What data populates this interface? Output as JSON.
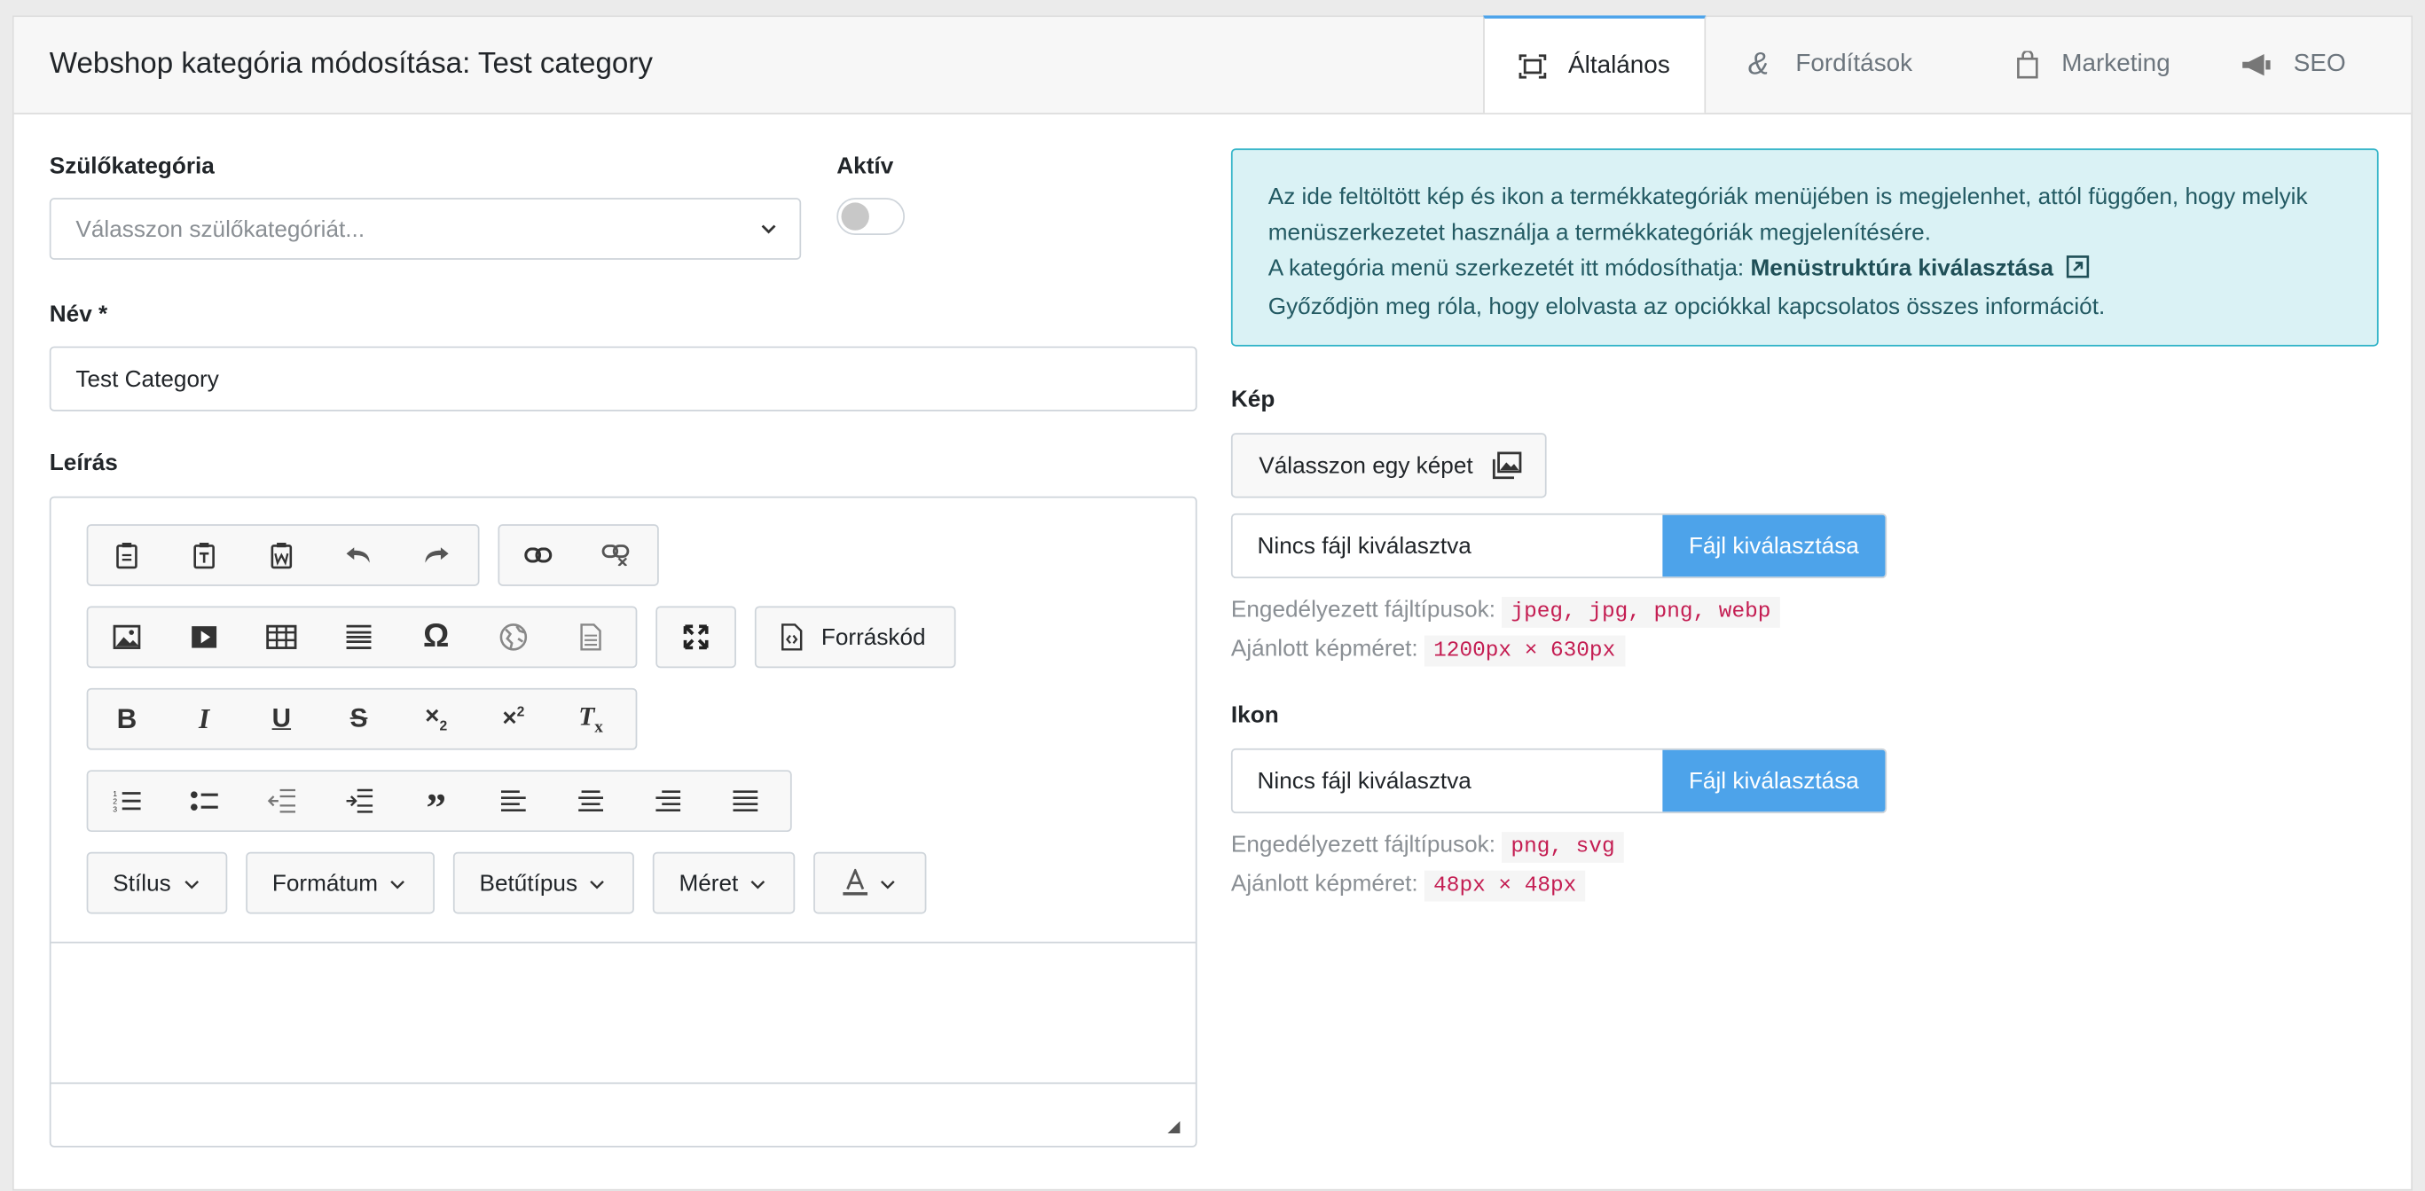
{
  "header": {
    "title": "Webshop kategória módosítása: Test category",
    "tabs": [
      {
        "label": "Általános",
        "icon": "frame-icon",
        "active": true
      },
      {
        "label": "Fordítások",
        "icon": "ampersand-icon",
        "active": false
      },
      {
        "label": "Marketing",
        "icon": "shopping-bag-icon",
        "active": false
      },
      {
        "label": "SEO",
        "icon": "megaphone-icon",
        "active": false
      }
    ]
  },
  "form": {
    "parent_label": "Szülőkategória",
    "parent_placeholder": "Válasszon szülőkategóriát...",
    "active_label": "Aktív",
    "active_value": false,
    "name_label": "Név *",
    "name_value": "Test Category",
    "description_label": "Leírás"
  },
  "editor": {
    "source_button": "Forráskód",
    "dropdowns": [
      "Stílus",
      "Formátum",
      "Betűtípus",
      "Méret"
    ]
  },
  "info": {
    "line1": "Az ide feltöltött kép és ikon a termékkategóriák menüjében is megjelenhet, attól függően, hogy melyik menüszerkezetet használja a termékkategóriák megjelenítésére.",
    "line2_prefix": "A kategória menü szerkezetét itt módosíthatja:",
    "line2_link": "Menüstruktúra kiválasztása",
    "line3": "Győződjön meg róla, hogy elolvasta az opciókkal kapcsolatos összes információt."
  },
  "image": {
    "label": "Kép",
    "pick_button": "Válasszon egy képet",
    "file_value": "Nincs fájl kiválasztva",
    "file_button": "Fájl kiválasztása",
    "types_label": "Engedélyezett fájltípusok:",
    "types_value": "jpeg, jpg, png, webp",
    "size_label": "Ajánlott képméret:",
    "size_value": "1200px × 630px"
  },
  "icon": {
    "label": "Ikon",
    "file_value": "Nincs fájl kiválasztva",
    "file_button": "Fájl kiválasztása",
    "types_label": "Engedélyezett fájltípusok:",
    "types_value": "png, svg",
    "size_label": "Ajánlott képméret:",
    "size_value": "48px × 48px"
  },
  "colors": {
    "accent": "#4da3ea",
    "info_bg": "#daf2f5",
    "info_border": "#32b4c8",
    "code": "#c41d52"
  }
}
